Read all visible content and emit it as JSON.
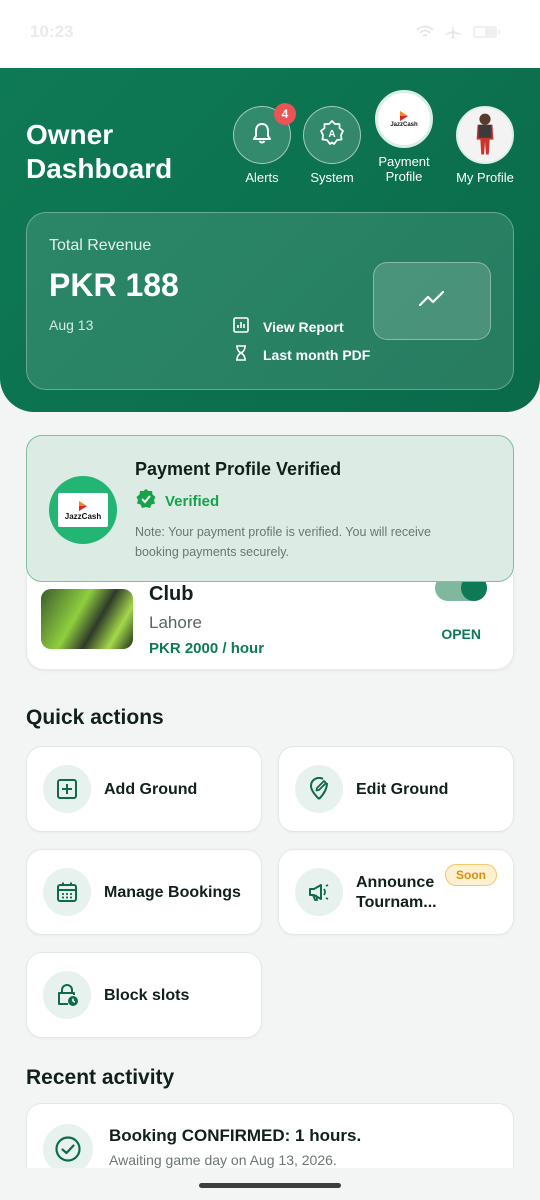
{
  "status_bar": {
    "time": "10:23"
  },
  "header": {
    "title_line1": "Owner",
    "title_line2": "Dashboard",
    "buttons": {
      "alerts": {
        "label": "Alerts",
        "badge": "4"
      },
      "system": {
        "label": "System"
      },
      "payment_profile": {
        "label_line1": "Payment",
        "label_line2": "Profile",
        "logo_text": "JazzCash"
      },
      "my_profile": {
        "label": "My Profile"
      }
    }
  },
  "revenue": {
    "label": "Total Revenue",
    "amount": "PKR 188",
    "date": "Aug 13",
    "view_report": "View Report",
    "last_month_pdf": "Last month PDF"
  },
  "verification": {
    "title": "Payment Profile Verified",
    "status": "Verified",
    "note": "Note: Your payment profile is verified. You will receive booking payments securely.",
    "logo_text": "JazzCash"
  },
  "ground": {
    "name": "Club",
    "city": "Lahore",
    "price": "PKR 2000 / hour",
    "status": "OPEN"
  },
  "quick_actions": {
    "title": "Quick actions",
    "items": [
      {
        "label": "Add Ground",
        "icon": "plus-square-icon"
      },
      {
        "label": "Edit Ground",
        "icon": "edit-location-icon"
      },
      {
        "label": "Manage Bookings",
        "icon": "calendar-icon"
      },
      {
        "label": "Announce Tournam...",
        "label_line1": "Announce",
        "label_line2": "Tournam...",
        "icon": "megaphone-icon",
        "badge": "Soon"
      },
      {
        "label": "Block slots",
        "icon": "lock-clock-icon"
      }
    ]
  },
  "recent_activity": {
    "title": "Recent activity",
    "items": [
      {
        "title": "Booking CONFIRMED: 1 hours.",
        "subtitle": "Awaiting game day on Aug 13, 2026."
      }
    ]
  },
  "colors": {
    "brand": "#0e7a55",
    "verified": "#16a34a",
    "badge": "#ea5455",
    "soon": "#d98f12"
  }
}
